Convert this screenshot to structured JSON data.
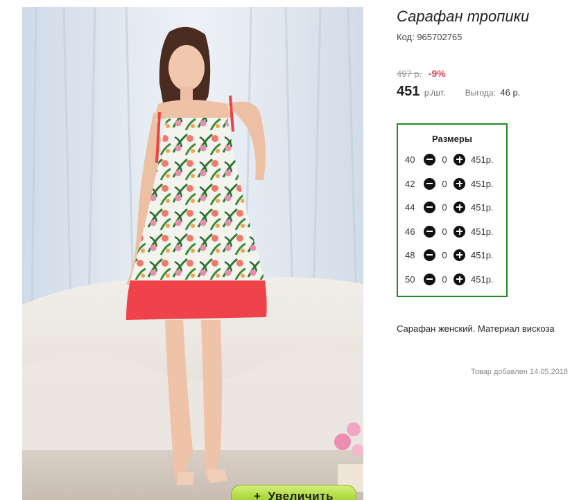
{
  "product": {
    "title": "Сарафан тропики",
    "code": "Код: 965702765",
    "photo_alt": "Сарафан тропики",
    "zoom_label": "Увеличить",
    "zoom_plus": "+"
  },
  "price": {
    "old": "497 р.",
    "discount": "-9%",
    "current": "451",
    "unit": "р./шт.",
    "benefit_label": "Выгода:",
    "benefit_value": "46 р."
  },
  "sizes": {
    "title": "Размеры",
    "rows": [
      {
        "size": "40",
        "qty": "0",
        "price": "451р."
      },
      {
        "size": "42",
        "qty": "0",
        "price": "451р."
      },
      {
        "size": "44",
        "qty": "0",
        "price": "451р."
      },
      {
        "size": "46",
        "qty": "0",
        "price": "451р."
      },
      {
        "size": "48",
        "qty": "0",
        "price": "451р."
      },
      {
        "size": "50",
        "qty": "0",
        "price": "451р."
      }
    ]
  },
  "description": "Сарафан женский. Материал вискоза",
  "added_date": "Товар добавлен 14.05.2018",
  "colors": {
    "sizes_border": "#1e8a1e",
    "discount": "#e0434f",
    "zoom_button": "#a9d83a",
    "dress_hem": "#f0424a"
  },
  "icons": {
    "minus": "minus-circle-icon",
    "plus": "plus-circle-icon"
  }
}
